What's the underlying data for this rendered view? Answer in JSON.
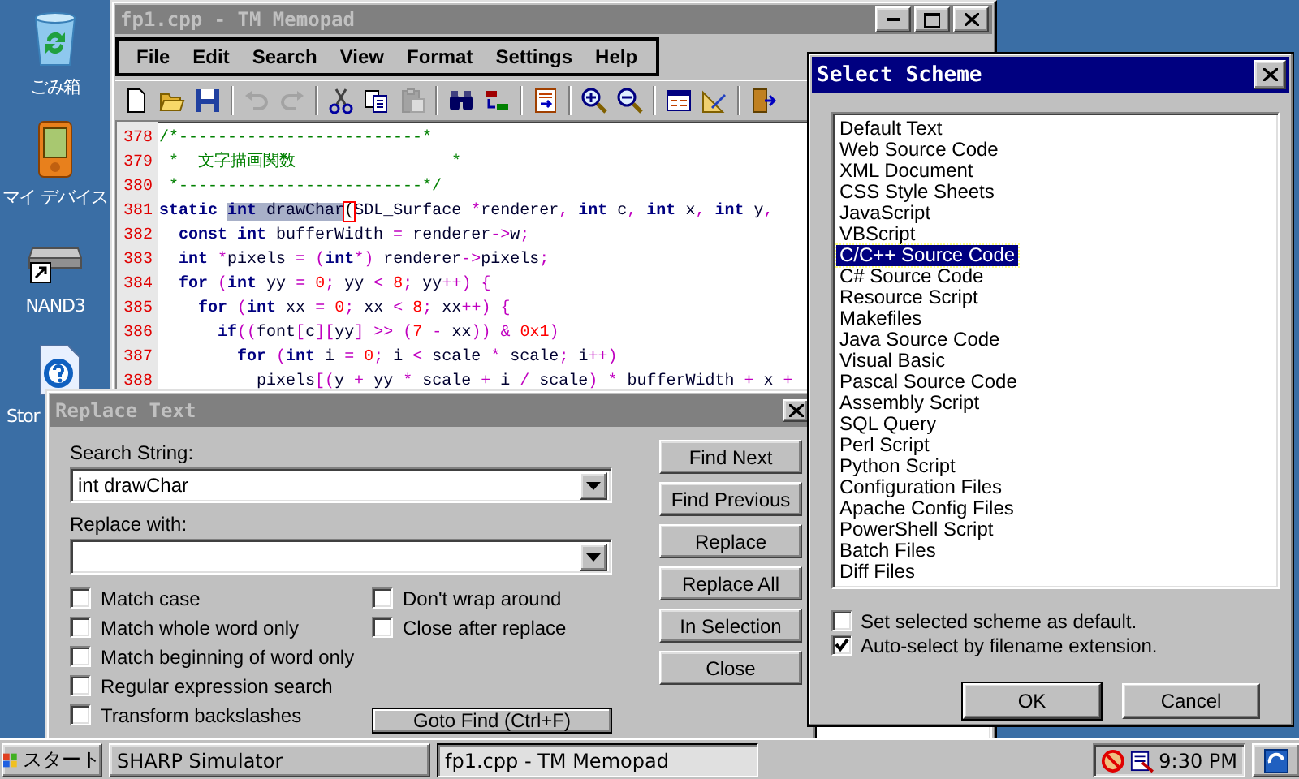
{
  "desktop_icons": [
    {
      "label": "ごみ箱",
      "kind": "trash"
    },
    {
      "label": "マイ デバイス",
      "kind": "device"
    },
    {
      "label": "NAND3",
      "kind": "drive"
    },
    {
      "label": "Stor",
      "kind": "help"
    }
  ],
  "editor_window": {
    "title": "fp1.cpp - TM Memopad",
    "active": false,
    "menu": [
      "File",
      "Edit",
      "Search",
      "View",
      "Format",
      "Settings",
      "Help"
    ],
    "toolbar": [
      {
        "kind": "new",
        "disabled": false
      },
      {
        "kind": "open",
        "disabled": false
      },
      {
        "kind": "save",
        "disabled": false
      },
      {
        "kind": "separator"
      },
      {
        "kind": "undo",
        "disabled": true
      },
      {
        "kind": "redo",
        "disabled": true
      },
      {
        "kind": "separator"
      },
      {
        "kind": "cut",
        "disabled": false
      },
      {
        "kind": "copy",
        "disabled": false
      },
      {
        "kind": "paste",
        "disabled": true
      },
      {
        "kind": "separator"
      },
      {
        "kind": "find",
        "disabled": false
      },
      {
        "kind": "replace",
        "disabled": false
      },
      {
        "kind": "separator"
      },
      {
        "kind": "insert",
        "disabled": false
      },
      {
        "kind": "separator"
      },
      {
        "kind": "zoom-in",
        "disabled": false
      },
      {
        "kind": "zoom-out",
        "disabled": false
      },
      {
        "kind": "separator"
      },
      {
        "kind": "panel",
        "disabled": false
      },
      {
        "kind": "ruler",
        "disabled": false
      },
      {
        "kind": "separator"
      },
      {
        "kind": "exit",
        "disabled": false
      }
    ],
    "lines": [
      {
        "number": "378",
        "segments": [
          {
            "kind": "com",
            "text": "/*-------------------------*"
          }
        ]
      },
      {
        "number": "379",
        "segments": [
          {
            "kind": "com",
            "text": " *  文字描画関数                *"
          }
        ]
      },
      {
        "number": "380",
        "segments": [
          {
            "kind": "com",
            "text": " *-------------------------*/"
          }
        ]
      },
      {
        "number": "381",
        "segments": [
          {
            "kind": "kw",
            "text": "static "
          },
          {
            "kind": "selkw",
            "text": "int"
          },
          {
            "kind": "seltxt",
            "text": " drawChar"
          },
          {
            "kind": "br",
            "text": "("
          },
          {
            "kind": "txt",
            "text": "SDL_Surface "
          },
          {
            "kind": "op",
            "text": "*"
          },
          {
            "kind": "txt",
            "text": "renderer"
          },
          {
            "kind": "op",
            "text": ","
          },
          {
            "kind": "kw",
            "text": " int"
          },
          {
            "kind": "txt",
            "text": " c"
          },
          {
            "kind": "op",
            "text": ","
          },
          {
            "kind": "kw",
            "text": " int"
          },
          {
            "kind": "txt",
            "text": " x"
          },
          {
            "kind": "op",
            "text": ","
          },
          {
            "kind": "kw",
            "text": " int"
          },
          {
            "kind": "txt",
            "text": " y"
          },
          {
            "kind": "op",
            "text": ","
          }
        ]
      },
      {
        "number": "382",
        "segments": [
          {
            "kind": "kw",
            "text": "  const"
          },
          {
            "kind": "kw",
            "text": " int"
          },
          {
            "kind": "txt",
            "text": " bufferWidth "
          },
          {
            "kind": "op",
            "text": "="
          },
          {
            "kind": "txt",
            "text": " renderer"
          },
          {
            "kind": "op",
            "text": "->"
          },
          {
            "kind": "txt",
            "text": "w"
          },
          {
            "kind": "op",
            "text": ";"
          }
        ]
      },
      {
        "number": "383",
        "segments": [
          {
            "kind": "kw",
            "text": "  int"
          },
          {
            "kind": "op",
            "text": " *"
          },
          {
            "kind": "txt",
            "text": "pixels "
          },
          {
            "kind": "op",
            "text": "="
          },
          {
            "kind": "op",
            "text": " ("
          },
          {
            "kind": "kw",
            "text": "int"
          },
          {
            "kind": "op",
            "text": "*)"
          },
          {
            "kind": "txt",
            "text": " renderer"
          },
          {
            "kind": "op",
            "text": "->"
          },
          {
            "kind": "txt",
            "text": "pixels"
          },
          {
            "kind": "op",
            "text": ";"
          }
        ]
      },
      {
        "number": "384",
        "segments": [
          {
            "kind": "kw",
            "text": "  for"
          },
          {
            "kind": "op",
            "text": " ("
          },
          {
            "kind": "kw",
            "text": "int"
          },
          {
            "kind": "txt",
            "text": " yy "
          },
          {
            "kind": "op",
            "text": "="
          },
          {
            "kind": "num",
            "text": " 0"
          },
          {
            "kind": "op",
            "text": ";"
          },
          {
            "kind": "txt",
            "text": " yy "
          },
          {
            "kind": "op",
            "text": "<"
          },
          {
            "kind": "num",
            "text": " 8"
          },
          {
            "kind": "op",
            "text": ";"
          },
          {
            "kind": "txt",
            "text": " yy"
          },
          {
            "kind": "op",
            "text": "++)"
          },
          {
            "kind": "op",
            "text": " {"
          }
        ]
      },
      {
        "number": "385",
        "segments": [
          {
            "kind": "kw",
            "text": "    for"
          },
          {
            "kind": "op",
            "text": " ("
          },
          {
            "kind": "kw",
            "text": "int"
          },
          {
            "kind": "txt",
            "text": " xx "
          },
          {
            "kind": "op",
            "text": "="
          },
          {
            "kind": "num",
            "text": " 0"
          },
          {
            "kind": "op",
            "text": ";"
          },
          {
            "kind": "txt",
            "text": " xx "
          },
          {
            "kind": "op",
            "text": "<"
          },
          {
            "kind": "num",
            "text": " 8"
          },
          {
            "kind": "op",
            "text": ";"
          },
          {
            "kind": "txt",
            "text": " xx"
          },
          {
            "kind": "op",
            "text": "++)"
          },
          {
            "kind": "op",
            "text": " {"
          }
        ]
      },
      {
        "number": "386",
        "segments": [
          {
            "kind": "kw",
            "text": "      if"
          },
          {
            "kind": "op",
            "text": "(("
          },
          {
            "kind": "txt",
            "text": "font"
          },
          {
            "kind": "op",
            "text": "["
          },
          {
            "kind": "txt",
            "text": "c"
          },
          {
            "kind": "op",
            "text": "]["
          },
          {
            "kind": "txt",
            "text": "yy"
          },
          {
            "kind": "op",
            "text": "]"
          },
          {
            "kind": "op",
            "text": " >>"
          },
          {
            "kind": "op",
            "text": " ("
          },
          {
            "kind": "num",
            "text": "7"
          },
          {
            "kind": "op",
            "text": " -"
          },
          {
            "kind": "txt",
            "text": " xx"
          },
          {
            "kind": "op",
            "text": "))"
          },
          {
            "kind": "op",
            "text": " &"
          },
          {
            "kind": "num",
            "text": " 0x1"
          },
          {
            "kind": "op",
            "text": ")"
          }
        ]
      },
      {
        "number": "387",
        "segments": [
          {
            "kind": "kw",
            "text": "        for"
          },
          {
            "kind": "op",
            "text": " ("
          },
          {
            "kind": "kw",
            "text": "int"
          },
          {
            "kind": "txt",
            "text": " i "
          },
          {
            "kind": "op",
            "text": "="
          },
          {
            "kind": "num",
            "text": " 0"
          },
          {
            "kind": "op",
            "text": ";"
          },
          {
            "kind": "txt",
            "text": " i "
          },
          {
            "kind": "op",
            "text": "<"
          },
          {
            "kind": "txt",
            "text": " scale "
          },
          {
            "kind": "op",
            "text": "*"
          },
          {
            "kind": "txt",
            "text": " scale"
          },
          {
            "kind": "op",
            "text": ";"
          },
          {
            "kind": "txt",
            "text": " i"
          },
          {
            "kind": "op",
            "text": "++)"
          }
        ]
      },
      {
        "number": "388",
        "segments": [
          {
            "kind": "txt",
            "text": "          pixels"
          },
          {
            "kind": "op",
            "text": "[("
          },
          {
            "kind": "txt",
            "text": "y "
          },
          {
            "kind": "op",
            "text": "+"
          },
          {
            "kind": "txt",
            "text": " yy "
          },
          {
            "kind": "op",
            "text": "*"
          },
          {
            "kind": "txt",
            "text": " scale "
          },
          {
            "kind": "op",
            "text": "+"
          },
          {
            "kind": "txt",
            "text": " i "
          },
          {
            "kind": "op",
            "text": "/"
          },
          {
            "kind": "txt",
            "text": " scale"
          },
          {
            "kind": "op",
            "text": ")"
          },
          {
            "kind": "op",
            "text": " *"
          },
          {
            "kind": "txt",
            "text": " bufferWidth "
          },
          {
            "kind": "op",
            "text": "+"
          },
          {
            "kind": "txt",
            "text": " x "
          },
          {
            "kind": "op",
            "text": "+"
          }
        ]
      }
    ]
  },
  "replace_dialog": {
    "title": "Replace Text",
    "active": false,
    "search_label": "Search String:",
    "search_value": "int drawChar",
    "replace_label": "Replace with:",
    "options_left": [
      {
        "label": "Match case",
        "checked": false
      },
      {
        "label": "Match whole word only",
        "checked": false
      },
      {
        "label": "Match beginning of word only",
        "checked": false
      },
      {
        "label": "Regular expression search",
        "checked": false
      },
      {
        "label": "Transform backslashes",
        "checked": false
      }
    ],
    "options_right": [
      {
        "label": "Don't wrap around",
        "checked": false
      },
      {
        "label": "Close after replace",
        "checked": false
      }
    ],
    "goto_button": "Goto Find (Ctrl+F)",
    "buttons": [
      "Find Next",
      "Find Previous",
      "Replace",
      "Replace All",
      "In Selection",
      "Close"
    ]
  },
  "scheme_dialog": {
    "title": "Select Scheme",
    "active": true,
    "schemes": [
      {
        "label": "Default Text",
        "selected": false
      },
      {
        "label": "Web Source Code",
        "selected": false
      },
      {
        "label": "XML Document",
        "selected": false
      },
      {
        "label": "CSS Style Sheets",
        "selected": false
      },
      {
        "label": "JavaScript",
        "selected": false
      },
      {
        "label": "VBScript",
        "selected": false
      },
      {
        "label": "C/C++ Source Code",
        "selected": true
      },
      {
        "label": "C# Source Code",
        "selected": false
      },
      {
        "label": "Resource Script",
        "selected": false
      },
      {
        "label": "Makefiles",
        "selected": false
      },
      {
        "label": "Java Source Code",
        "selected": false
      },
      {
        "label": "Visual Basic",
        "selected": false
      },
      {
        "label": "Pascal Source Code",
        "selected": false
      },
      {
        "label": "Assembly Script",
        "selected": false
      },
      {
        "label": "SQL Query",
        "selected": false
      },
      {
        "label": "Perl Script",
        "selected": false
      },
      {
        "label": "Python Script",
        "selected": false
      },
      {
        "label": "Configuration Files",
        "selected": false
      },
      {
        "label": "Apache Config Files",
        "selected": false
      },
      {
        "label": "PowerShell Script",
        "selected": false
      },
      {
        "label": "Batch Files",
        "selected": false
      },
      {
        "label": "Diff Files",
        "selected": false
      }
    ],
    "options": [
      {
        "label": "Set selected scheme as default.",
        "checked": false
      },
      {
        "label": "Auto-select by filename extension.",
        "checked": true
      }
    ],
    "buttons": [
      "OK",
      "Cancel"
    ]
  },
  "taskbar": {
    "start": "スタート",
    "tasks": [
      {
        "label": "SHARP Simulator",
        "selected": false
      },
      {
        "label": "fp1.cpp - TM Memopad",
        "selected": true
      }
    ],
    "clock": "9:30 PM"
  }
}
